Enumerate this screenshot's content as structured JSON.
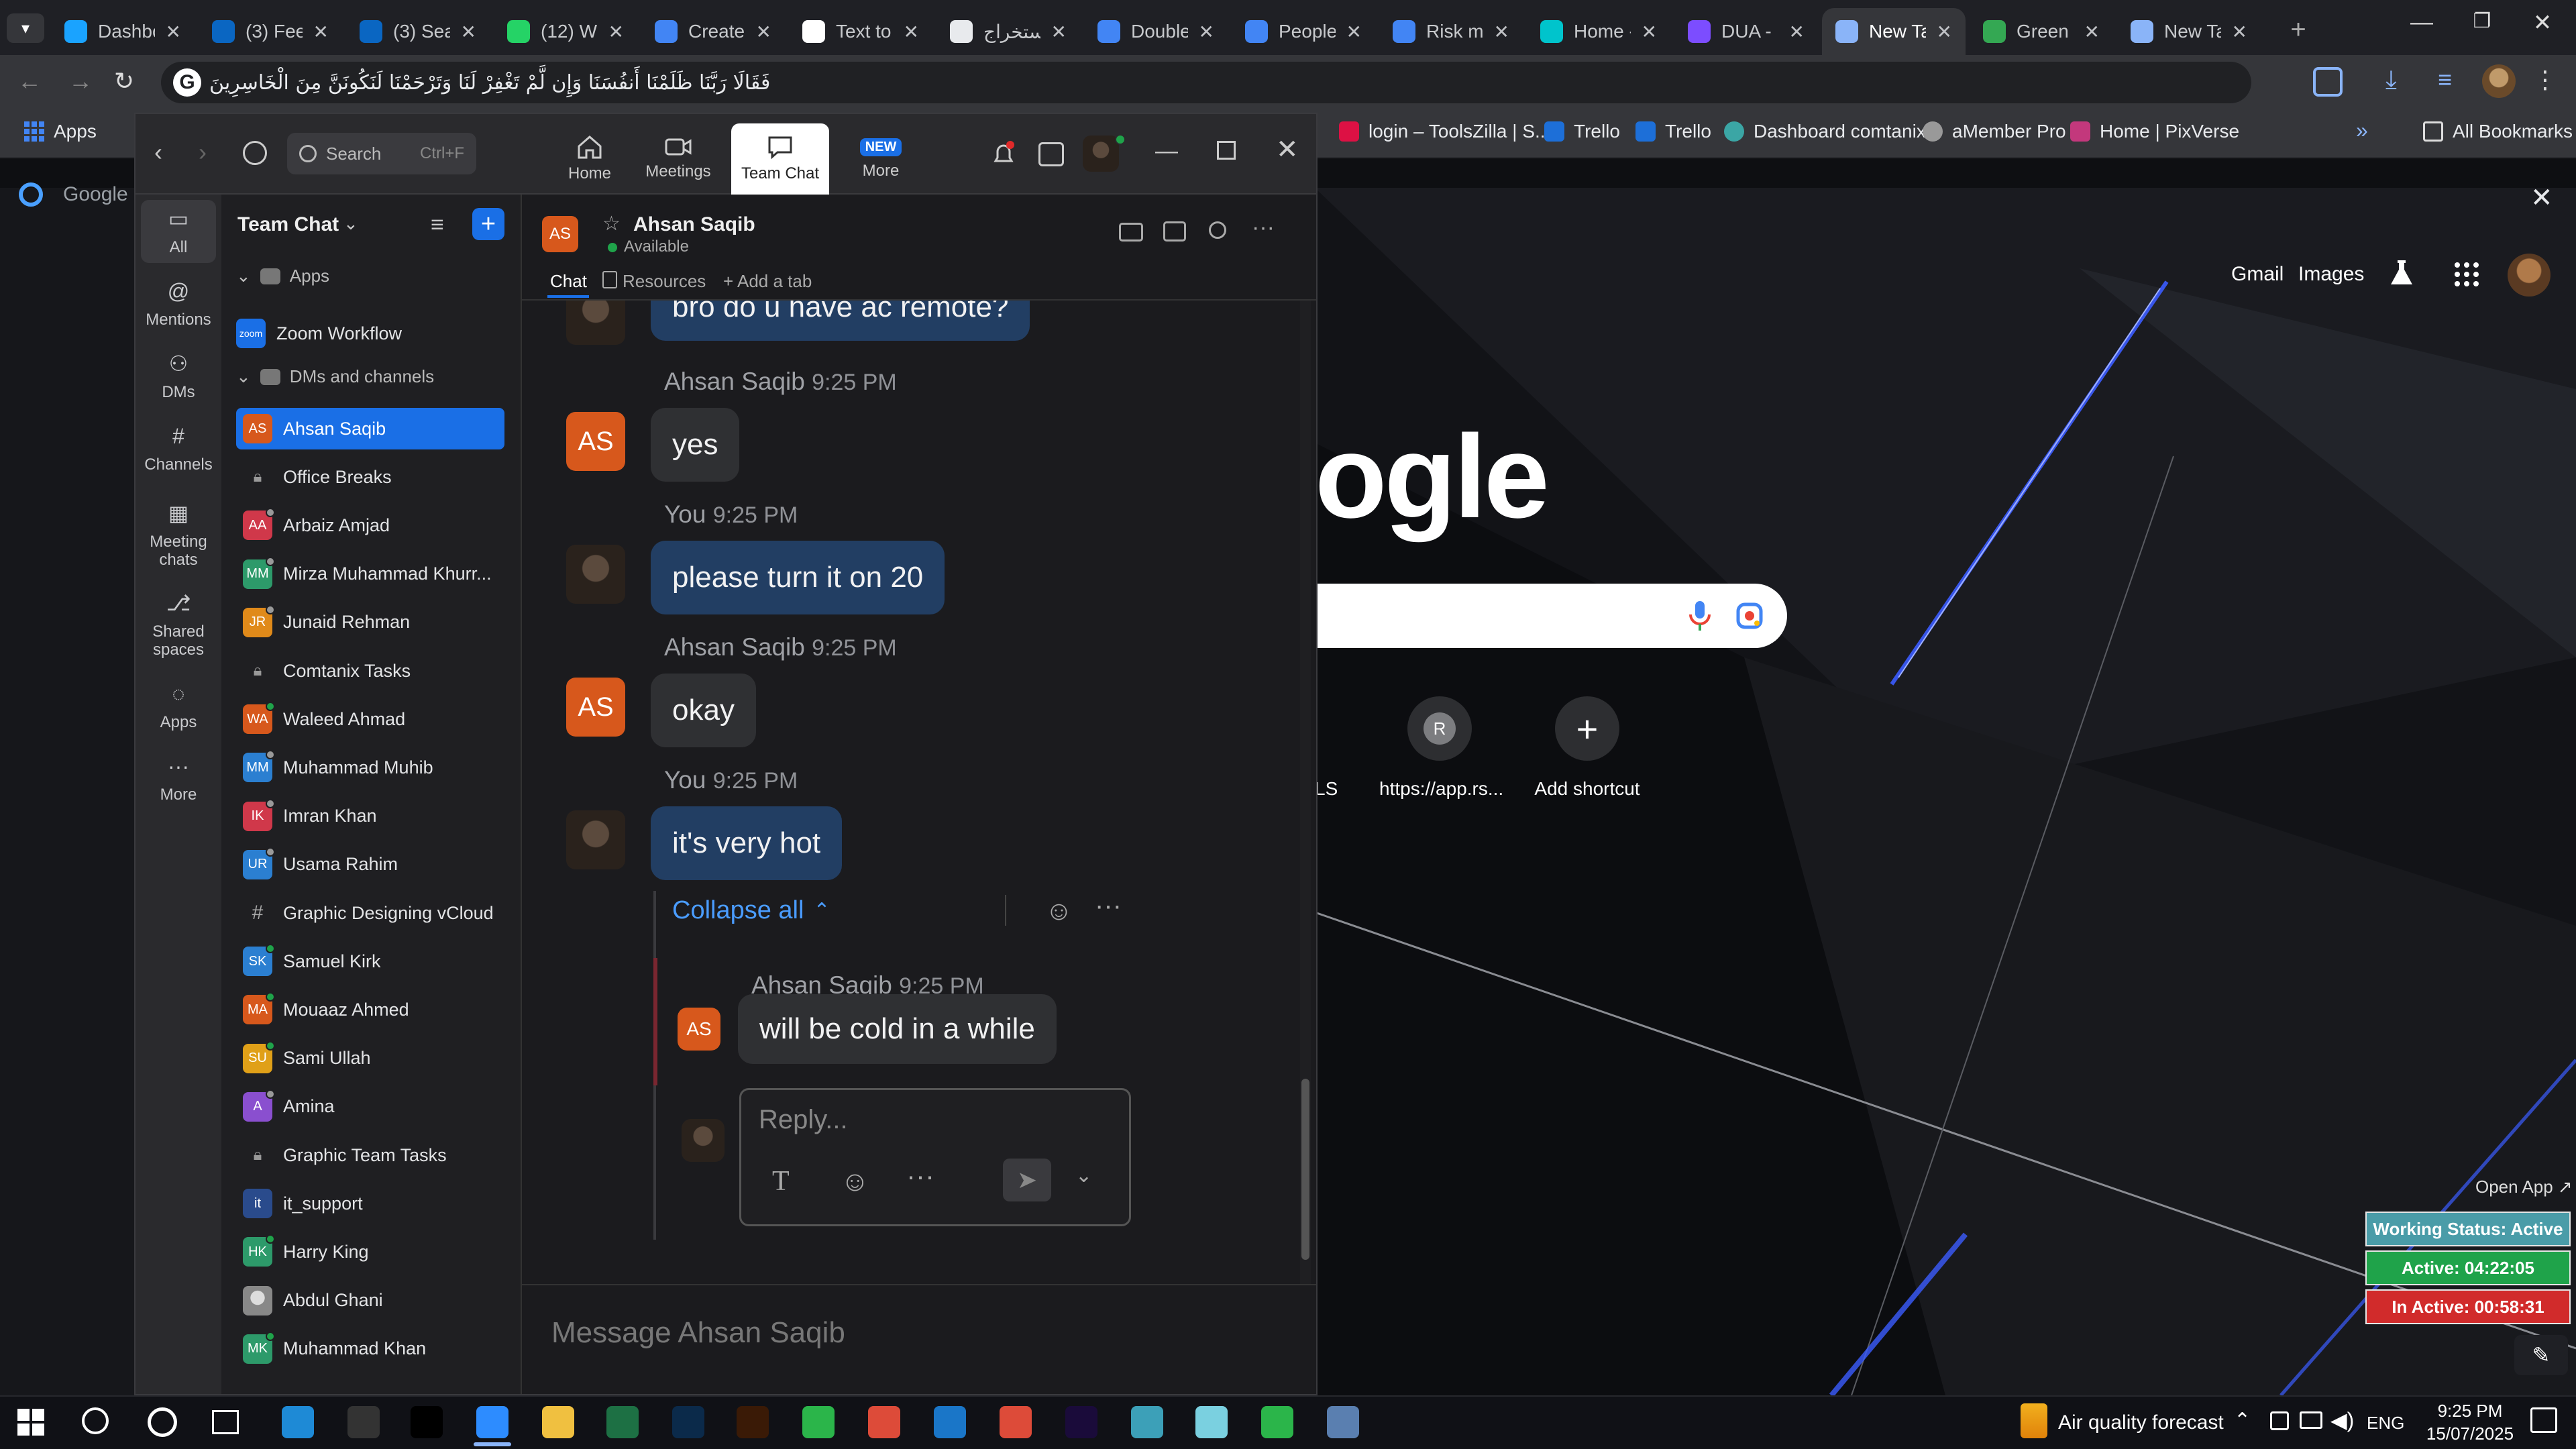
{
  "browser": {
    "tabs": [
      {
        "label": "Dashbo",
        "icon": "zilla-icon",
        "color": "#1aa3ff"
      },
      {
        "label": "(3) Fee",
        "icon": "linkedin-icon",
        "color": "#0a66c2"
      },
      {
        "label": "(3) Sea",
        "icon": "linkedin-icon",
        "color": "#0a66c2"
      },
      {
        "label": "(12) W",
        "icon": "whatsapp-icon",
        "color": "#25d366"
      },
      {
        "label": "Create",
        "icon": "docs-icon",
        "color": "#4285f4"
      },
      {
        "label": "Text to",
        "icon": "text-icon",
        "color": "#ffffff"
      },
      {
        "label": "استخراج",
        "icon": "openai-icon",
        "color": "#e8eaed"
      },
      {
        "label": "Double",
        "icon": "docs-icon",
        "color": "#4285f4"
      },
      {
        "label": "People",
        "icon": "docs-icon",
        "color": "#4285f4"
      },
      {
        "label": "Risk m",
        "icon": "docs-icon",
        "color": "#4285f4"
      },
      {
        "label": "Home -",
        "icon": "canva-icon",
        "color": "#00c4cc"
      },
      {
        "label": "DUA -",
        "icon": "video-icon",
        "color": "#7c4dff"
      },
      {
        "label": "New Ta",
        "icon": "chrome-icon",
        "color": "#8ab4f8"
      },
      {
        "label": "Green",
        "icon": "flag-icon",
        "color": "#34a853"
      },
      {
        "label": "New Ta",
        "icon": "chrome-icon",
        "color": "#8ab4f8"
      }
    ],
    "active_tab": 12,
    "address": "فَقَالَا رَبَّنَا ظَلَمْنَا أَنفُسَنَا وَإِن لَّمْ تَغْفِرْ لَنَا وَتَرْحَمْنَا لَنَكُونَنَّ مِنَ الْخَاسِرِينَ",
    "bookmarks": {
      "apps": "Apps",
      "items": [
        {
          "label": "login – ToolsZilla | S...",
          "color": "#d14"
        },
        {
          "label": "Trello",
          "color": "#1d6fd8"
        },
        {
          "label": "Trello",
          "color": "#1d6fd8"
        },
        {
          "label": "Dashboard comtanix",
          "color": "#3ba6a5"
        },
        {
          "label": "aMember Pro",
          "color": "#999"
        },
        {
          "label": "Home | PixVerse",
          "color": "#c3387c"
        }
      ],
      "all_bookmarks": "All Bookmarks"
    },
    "google_pill": "Google",
    "google_links": [
      "Gmail",
      "Images"
    ],
    "logo_partial": "ogle",
    "shortcuts": [
      {
        "label": "LS",
        "letter": ""
      },
      {
        "label": "https://app.rs...",
        "letter": "R"
      },
      {
        "label": "Add shortcut",
        "letter": "+"
      }
    ],
    "open_app": "Open App ↗"
  },
  "zoom": {
    "nav": {
      "search_placeholder": "Search",
      "search_shortcut": "Ctrl+F",
      "tabs": [
        {
          "label": "Home",
          "icon": "home-icon"
        },
        {
          "label": "Meetings",
          "icon": "video-icon"
        },
        {
          "label": "Team Chat",
          "icon": "chat-icon"
        },
        {
          "label": "More",
          "icon": "more-icon"
        }
      ],
      "new_badge": "NEW"
    },
    "rail": [
      {
        "label": "All",
        "icon": "chat-bubble-icon"
      },
      {
        "label": "Mentions",
        "icon": "at-icon"
      },
      {
        "label": "DMs",
        "icon": "people-icon"
      },
      {
        "label": "Channels",
        "icon": "hash-icon"
      },
      {
        "label": "Meeting chats",
        "icon": "calendar-icon"
      },
      {
        "label": "Shared spaces",
        "icon": "share-icon"
      },
      {
        "label": "Apps",
        "icon": "apps-icon"
      },
      {
        "label": "More",
        "icon": "ellipsis-icon"
      }
    ],
    "sidebar": {
      "title": "Team Chat",
      "section_apps": "Apps",
      "app_item": "Zoom Workflow",
      "section_dms": "DMs and channels",
      "items": [
        {
          "label": "Ahsan Saqib",
          "initials": "AS",
          "color": "#d7581c",
          "status": ""
        },
        {
          "label": "Office Breaks",
          "initials": "",
          "color": "#3a3a3e",
          "status": "lock"
        },
        {
          "label": "Arbaiz Amjad",
          "initials": "AA",
          "color": "#d0384a",
          "status": "away"
        },
        {
          "label": "Mirza Muhammad Khurr...",
          "initials": "MM",
          "color": "#2d9a6a",
          "status": "away"
        },
        {
          "label": "Junaid Rehman",
          "initials": "JR",
          "color": "#e08a1a",
          "status": "away"
        },
        {
          "label": "Comtanix Tasks",
          "initials": "",
          "color": "#3a3a3e",
          "status": "lock"
        },
        {
          "label": "Waleed Ahmad",
          "initials": "WA",
          "color": "#d7581c",
          "status": "online"
        },
        {
          "label": "Muhammad Muhib",
          "initials": "MM",
          "color": "#2b7fd1",
          "status": "away"
        },
        {
          "label": "Imran Khan",
          "initials": "IK",
          "color": "#d0384a",
          "status": "away"
        },
        {
          "label": "Usama Rahim",
          "initials": "UR",
          "color": "#2b7fd1",
          "status": "away"
        },
        {
          "label": "Graphic Designing vCloud",
          "initials": "#",
          "color": "#3a3a3e",
          "status": "channel"
        },
        {
          "label": "Samuel Kirk",
          "initials": "SK",
          "color": "#2b7fd1",
          "status": "online"
        },
        {
          "label": "Mouaaz Ahmed",
          "initials": "MA",
          "color": "#d7581c",
          "status": "online"
        },
        {
          "label": "Sami Ullah",
          "initials": "SU",
          "color": "#e0a018",
          "status": "online"
        },
        {
          "label": "Amina",
          "initials": "A",
          "color": "#8a4fcf",
          "status": "away"
        },
        {
          "label": "Graphic Team Tasks",
          "initials": "",
          "color": "#3a3a3e",
          "status": "lock"
        },
        {
          "label": "it_support",
          "initials": "it",
          "color": "#2a4b8c",
          "status": ""
        },
        {
          "label": "Harry King",
          "initials": "HK",
          "color": "#2d9a6a",
          "status": "online"
        },
        {
          "label": "Abdul Ghani",
          "initials": "",
          "color": "#eeeeee",
          "status": ""
        },
        {
          "label": "Muhammad Khan",
          "initials": "MK",
          "color": "#2d9a6a",
          "status": "online"
        }
      ]
    },
    "chat": {
      "contact": "Ahsan Saqib",
      "contact_initials": "AS",
      "status": "Available",
      "tabs": [
        "Chat",
        "Resources",
        "+ Add a tab"
      ],
      "messages": [
        {
          "sender": "",
          "time": "",
          "text": "bro do u have ac remote?",
          "mine": true
        },
        {
          "sender": "Ahsan Saqib",
          "time": "9:25 PM",
          "text": "yes",
          "mine": false
        },
        {
          "sender": "You",
          "time": "9:25 PM",
          "text": "please turn it on 20",
          "mine": true
        },
        {
          "sender": "Ahsan Saqib",
          "time": "9:25 PM",
          "text": "okay",
          "mine": false
        },
        {
          "sender": "You",
          "time": "9:25 PM",
          "text": "it's very hot",
          "mine": true
        }
      ],
      "collapse_all": "Collapse all",
      "thread_reply": {
        "sender": "Ahsan Saqib",
        "time": "9:25 PM",
        "text": "will be cold in a while"
      },
      "reply_placeholder": "Reply...",
      "composer_placeholder": "Message Ahsan Saqib"
    }
  },
  "widget": {
    "status": "Working Status: Active",
    "active": "Active: 04:22:05",
    "inactive": "In Active: 00:58:31",
    "colors": {
      "status": "#4a9ca8",
      "active": "#1fa34a",
      "inactive": "#d12b2b"
    }
  },
  "taskbar": {
    "weather": "Air quality forecast",
    "lang": "ENG",
    "time": "9:25 PM",
    "date": "15/07/2025"
  }
}
